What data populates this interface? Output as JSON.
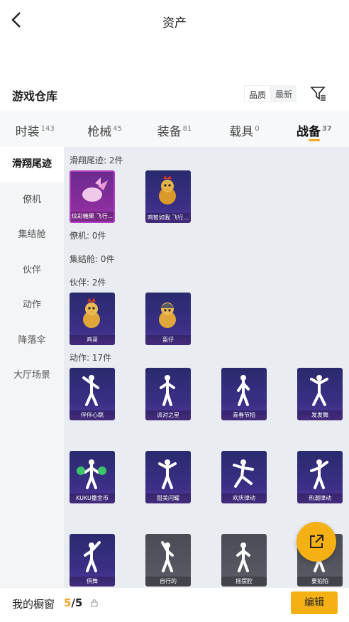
{
  "header": {
    "title": "资产"
  },
  "section": {
    "title": "游戏仓库",
    "sort_quality": "品质",
    "sort_newest": "最新"
  },
  "tabs": [
    {
      "label": "时装",
      "count": "143"
    },
    {
      "label": "枪械",
      "count": "45"
    },
    {
      "label": "装备",
      "count": "81"
    },
    {
      "label": "载具",
      "count": "0"
    },
    {
      "label": "战备",
      "count": "37"
    }
  ],
  "sidebar": [
    "滑翔尾迹",
    "僚机",
    "集结舱",
    "伙伴",
    "动作",
    "降落伞",
    "大厅场景"
  ],
  "categories": {
    "trail": "滑翔尾迹: 2件",
    "wingman": "僚机: 0件",
    "pod": "集结舱: 0件",
    "partner": "伙伴: 2件",
    "emote": "动作: 17件"
  },
  "items": {
    "trail": [
      "炫彩糖果 飞行...",
      "鸡智如我 飞行..."
    ],
    "partner": [
      "鸡哥",
      "盔仔"
    ],
    "emote": [
      "伴伴心跳",
      "派对之星",
      "青春节拍",
      "发发舞",
      "KUKU撒金币",
      "甜美闪耀",
      "欢庆律动",
      "热潮律动",
      "俱舞",
      "自行的",
      "摇摆腔",
      "要拍拍"
    ]
  },
  "bottom": {
    "showcase": "我的橱窗",
    "current": "5",
    "total": "/5",
    "edit": "编辑"
  },
  "colors": {
    "accent": "#f5b014",
    "card": "#3b2f86"
  }
}
